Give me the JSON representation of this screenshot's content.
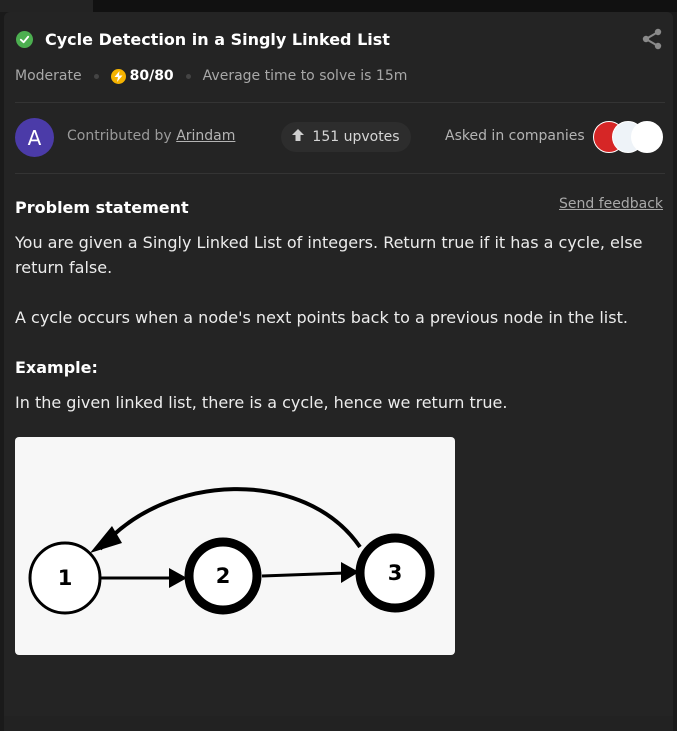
{
  "problem": {
    "title": "Cycle Detection in a Singly Linked List",
    "difficulty": "Moderate",
    "score": "80/80",
    "avg_time": "Average time to solve is 15m"
  },
  "contributor": {
    "avatar_letter": "A",
    "prefix": "Contributed by",
    "name": "Arindam"
  },
  "upvotes": "151 upvotes",
  "companies_label": "Asked in companies",
  "statement": {
    "heading": "Problem statement",
    "feedback": "Send feedback",
    "p1": "You are given a Singly Linked List of integers. Return true if it has a cycle, else return false.",
    "p2": "A cycle occurs when a node's next points back to a previous node in the list.",
    "example_heading": "Example:",
    "p3": "In the given linked list, there is a cycle, hence we return true."
  },
  "diagram": {
    "nodes": [
      "1",
      "2",
      "3"
    ]
  },
  "colors": {
    "success": "#4caf50",
    "bolt": "#f5b300",
    "avatar": "#4b3ba8",
    "panel": "#242424"
  },
  "icons": [
    "check-icon",
    "share-icon",
    "bolt-icon",
    "upvote-arrow-icon"
  ]
}
